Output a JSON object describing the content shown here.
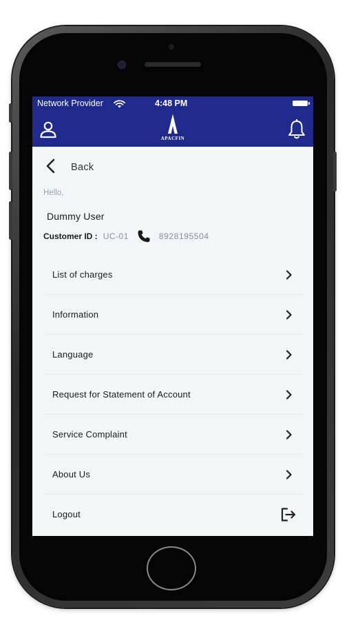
{
  "status_bar": {
    "provider": "Network Provider",
    "time": "4:48 PM"
  },
  "header": {
    "logo_text": "APACFIN",
    "icons": [
      "user-icon",
      "bell-icon"
    ],
    "color": "#1f2a8c"
  },
  "nav": {
    "back_label": "Back"
  },
  "profile": {
    "greeting": "Hello,",
    "name": "Dummy User",
    "customer_id_label": "Customer ID :",
    "customer_id_value": "UC-01",
    "phone": "8928195504"
  },
  "menu": {
    "items": [
      {
        "label": "List of charges"
      },
      {
        "label": "Information"
      },
      {
        "label": "Language"
      },
      {
        "label": "Request for Statement of Account"
      },
      {
        "label": "Service Complaint"
      },
      {
        "label": "About Us"
      },
      {
        "label": "Logout"
      }
    ]
  },
  "colors": {
    "background": "#f1f7f8",
    "header": "#1f2a8c",
    "muted_text": "#888f94"
  }
}
